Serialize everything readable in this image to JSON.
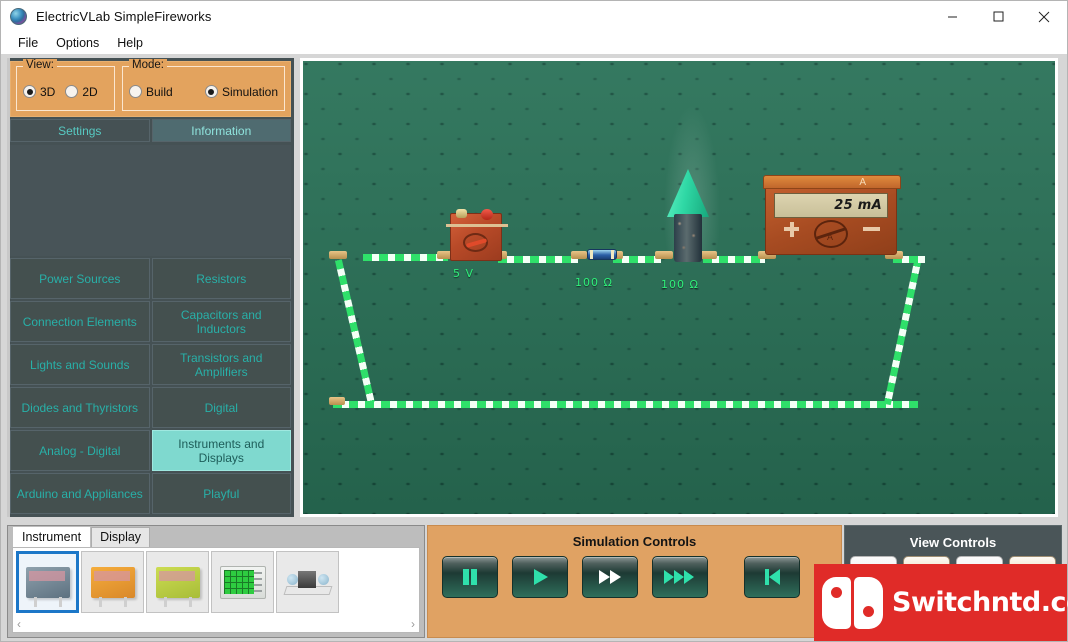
{
  "window": {
    "title": "ElectricVLab  SimpleFireworks",
    "app_icon": "electricvlab-sphere-icon",
    "controls": {
      "minimize": "minimize-icon",
      "maximize": "maximize-icon",
      "close": "close-icon"
    }
  },
  "menubar": {
    "items": [
      "File",
      "Options",
      "Help"
    ]
  },
  "view_mode_panel": {
    "view": {
      "legend": "View:",
      "options": [
        "3D",
        "2D"
      ],
      "selected": "3D"
    },
    "mode": {
      "legend": "Mode:",
      "options": [
        "Build",
        "Simulation"
      ],
      "selected": "Simulation"
    }
  },
  "side_tabs": {
    "items": [
      "Settings",
      "Information"
    ],
    "active": "Information"
  },
  "categories": {
    "items": [
      {
        "label": "Power Sources",
        "selected": false
      },
      {
        "label": "Resistors",
        "selected": false
      },
      {
        "label": "Connection Elements",
        "selected": false
      },
      {
        "label": "Capacitors and Inductors",
        "selected": false
      },
      {
        "label": "Lights and Sounds",
        "selected": false
      },
      {
        "label": "Transistors and Amplifiers",
        "selected": false
      },
      {
        "label": "Diodes and Thyristors",
        "selected": false
      },
      {
        "label": "Digital",
        "selected": false
      },
      {
        "label": "Analog - Digital",
        "selected": false
      },
      {
        "label": "Instruments and Displays",
        "selected": true
      },
      {
        "label": "Arduino and Appliances",
        "selected": false
      },
      {
        "label": "Playful",
        "selected": false
      }
    ]
  },
  "circuit": {
    "components": [
      {
        "name": "battery",
        "label": "5 V"
      },
      {
        "name": "resistor",
        "label": "100 Ω"
      },
      {
        "name": "firework-rocket",
        "label": "100 Ω"
      },
      {
        "name": "ammeter",
        "reading": "25 mA",
        "unit_symbol": "A"
      }
    ],
    "board_color": "#2a7258",
    "wire_color": "#2fe06a"
  },
  "instrument_panel": {
    "tabs": [
      "Instrument",
      "Display"
    ],
    "active_tab": "Instrument",
    "thumbnails": [
      {
        "name": "gray-panel-meter",
        "selected": true
      },
      {
        "name": "orange-ammeter",
        "selected": false
      },
      {
        "name": "yellow-voltmeter",
        "selected": false
      },
      {
        "name": "oscilloscope",
        "selected": false
      },
      {
        "name": "galvanometer",
        "selected": false
      }
    ],
    "scroll_left": "‹",
    "scroll_right": "›"
  },
  "simulation_controls": {
    "title": "Simulation Controls",
    "buttons": [
      {
        "name": "pause-button",
        "icon": "pause-icon"
      },
      {
        "name": "play-button",
        "icon": "play-icon"
      },
      {
        "name": "fast-forward-button",
        "icon": "fast-forward-icon"
      },
      {
        "name": "very-fast-forward-button",
        "icon": "triple-forward-icon"
      },
      {
        "name": "restart-button",
        "icon": "skip-back-icon"
      }
    ]
  },
  "view_controls": {
    "title": "View Controls",
    "buttons": [
      {
        "name": "pan-left-button",
        "icon": "left-arrow-icon"
      },
      {
        "name": "pan-up-button",
        "icon": "up-arrow-icon"
      },
      {
        "name": "pan-right-button",
        "icon": "right-arrow-icon"
      },
      {
        "name": "zoom-in-button",
        "icon": "magnifier-plus-icon"
      }
    ]
  },
  "watermark": {
    "text": "Switchntd.com",
    "color": "#e02b28"
  }
}
